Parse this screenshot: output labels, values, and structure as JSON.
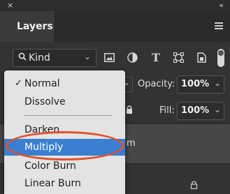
{
  "panel": {
    "tab_label": "Layers",
    "close_glyph": "×",
    "collapse_glyph": "«"
  },
  "filter": {
    "search_glyph": "🔍",
    "kind_label": "Kind",
    "chevron": "⌄",
    "icons": [
      "image-filter-icon",
      "adjustment-filter-icon",
      "type-filter-icon",
      "shape-filter-icon",
      "smart-object-filter-icon"
    ],
    "type_glyph": "T"
  },
  "blend": {
    "opacity_label": "Opacity:",
    "opacity_value": "100%",
    "fill_label": "Fill:",
    "fill_value": "100%",
    "chevron": "⌄"
  },
  "layer": {
    "name_visible_part": "m"
  },
  "dropdown": {
    "check_glyph": "✓",
    "items": [
      {
        "label": "Normal",
        "checked": true
      },
      {
        "label": "Dissolve"
      },
      {
        "label": "Darken"
      },
      {
        "label": "Multiply",
        "selected": true
      },
      {
        "label": "Color Burn"
      },
      {
        "label": "Linear Burn"
      }
    ]
  },
  "colors": {
    "panel_bg": "#333333",
    "menu_bg": "#e3e3e3",
    "selection": "#3a7fd0",
    "annotation_ring": "#e2512e"
  }
}
